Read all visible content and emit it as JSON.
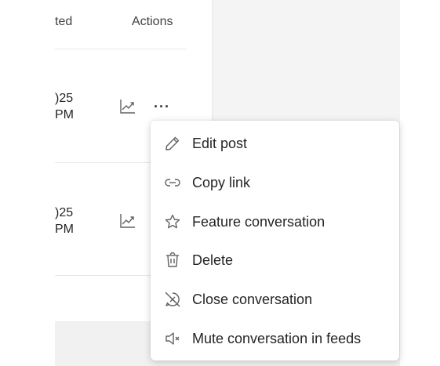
{
  "table": {
    "header_updated": "ted",
    "header_actions": "Actions",
    "rows": [
      {
        "date_line1": ")25",
        "date_line2": "PM"
      },
      {
        "date_line1": ")25",
        "date_line2": "PM"
      }
    ],
    "more_glyph": "···"
  },
  "menu": {
    "items": [
      {
        "label": "Edit post",
        "icon": "pencil-icon"
      },
      {
        "label": "Copy link",
        "icon": "link-icon"
      },
      {
        "label": "Feature conversation",
        "icon": "star-icon"
      },
      {
        "label": "Delete",
        "icon": "trash-icon"
      },
      {
        "label": "Close conversation",
        "icon": "close-conversation-icon"
      },
      {
        "label": "Mute conversation in feeds",
        "icon": "mute-speaker-icon"
      }
    ]
  },
  "colors": {
    "text": "#242424",
    "icon": "#616161",
    "divider": "#e8e8e8",
    "backdrop": "#f4f4f4"
  }
}
